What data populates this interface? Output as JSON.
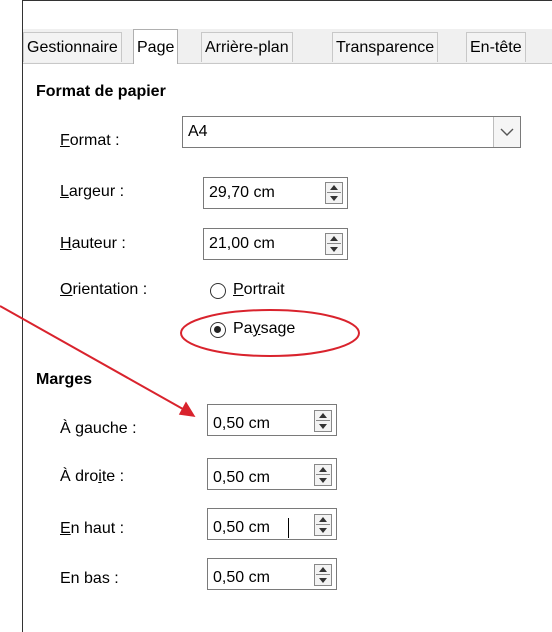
{
  "tabs": [
    {
      "label": "Gestionnaire",
      "active": false
    },
    {
      "label": "Page",
      "active": true
    },
    {
      "label": "Arrière-plan",
      "active": false
    },
    {
      "label": "Transparence",
      "active": false
    },
    {
      "label": "En-tête",
      "active": false
    }
  ],
  "paper": {
    "title": "Format de papier",
    "format_label_u": "F",
    "format_label_rest": "ormat :",
    "format_value": "A4",
    "width_label_u": "L",
    "width_label_rest": "argeur :",
    "width_value": "29,70 cm",
    "height_label_u": "H",
    "height_label_rest": "auteur :",
    "height_value": "21,00 cm",
    "orientation_label_u": "O",
    "orientation_label_rest": "rientation :",
    "portrait_u": "P",
    "portrait_rest": "ortrait",
    "landscape_pre": "Pa",
    "landscape_u": "y",
    "landscape_rest": "sage",
    "orientation_selected": "landscape"
  },
  "margins": {
    "title": "Marges",
    "left_pre": "À ",
    "left_u": "g",
    "left_rest": "auche :",
    "left_value": "0,50 cm",
    "right_pre": "À dro",
    "right_u": "i",
    "right_rest": "te :",
    "right_value": "0,50 cm",
    "top_u": "E",
    "top_rest": "n haut :",
    "top_value": "0,50 cm",
    "bottom_label": "En bas :",
    "bottom_value": "0,50 cm"
  },
  "annotation_color": "#d9232d"
}
